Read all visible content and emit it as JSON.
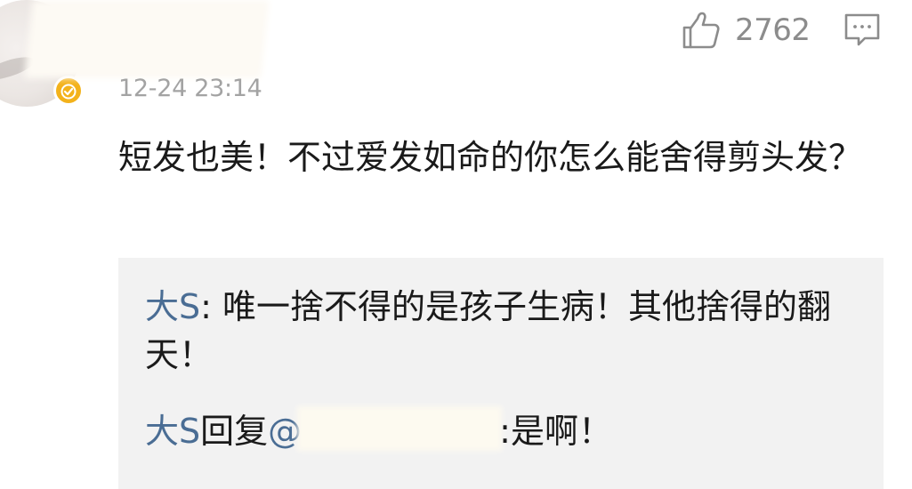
{
  "comment": {
    "timestamp": "12-24 23:14",
    "like_count": "2762",
    "text": "短发也美！不过爱发如命的你怎么能舍得剪头发？"
  },
  "icons": {
    "avatar": "avatar-image",
    "badge": "verified-badge-icon",
    "like": "thumbs-up-icon",
    "reply": "comment-icon"
  },
  "replies": [
    {
      "author": "大S",
      "separator": ": ",
      "text": "唯一捨不得的是孩子生病！其他捨得的翻天！"
    },
    {
      "author": "大S",
      "reply_word": "回复",
      "mention_prefix": "@",
      "separator": ":",
      "text": "是啊！"
    }
  ],
  "colors": {
    "link": "#4a6d94",
    "muted": "#a3a3a3",
    "badge": "#f3b21b",
    "reply_bg": "#f2f2f2"
  }
}
